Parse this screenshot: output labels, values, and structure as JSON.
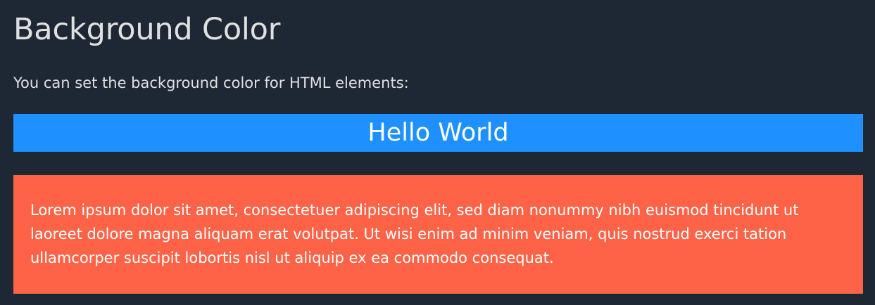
{
  "page": {
    "heading": "Background Color",
    "intro": "You can set the background color for HTML elements:",
    "hello_text": "Hello World",
    "lorem_text": "Lorem ipsum dolor sit amet, consectetuer adipiscing elit, sed diam nonummy nibh euismod tincidunt ut laoreet dolore magna aliquam erat volutpat. Ut wisi enim ad minim veniam, quis nostrud exerci tation ullamcorper suscipit lobortis nisl ut aliquip ex ea commodo consequat."
  },
  "colors": {
    "page_background": "#1e2834",
    "text": "#e0e0e0",
    "hello_background": "#1e90ff",
    "lorem_background": "#ff6347"
  }
}
